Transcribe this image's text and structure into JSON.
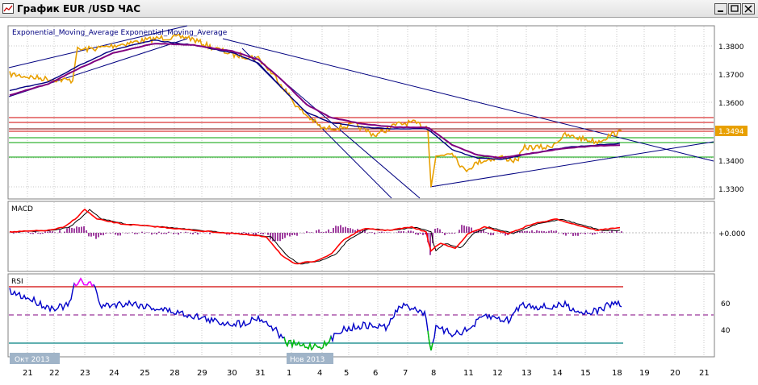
{
  "window": {
    "title": "График EUR /USD  ЧАС",
    "buttons": [
      "minimize",
      "maximize",
      "close"
    ]
  },
  "indicators_label": "Exponential_Moving_Average Exponential_Moving_Average",
  "price_axis": [
    "1.3800",
    "1.3700",
    "1.3600",
    "1.3400",
    "1.3300"
  ],
  "current_price": "1.3494",
  "macd_label": "MACD",
  "macd_axis": [
    "+0.000"
  ],
  "rsi_label": "RSI",
  "rsi_axis": [
    "60",
    "40"
  ],
  "month_labels": [
    "Окт 2013",
    "Нов 2013"
  ],
  "date_labels": [
    "21",
    "22",
    "23",
    "24",
    "25",
    "28",
    "29",
    "30",
    "31",
    "1",
    "4",
    "5",
    "6",
    "7",
    "8",
    "11",
    "12",
    "13",
    "14",
    "15",
    "18",
    "19",
    "20",
    "21"
  ],
  "colors": {
    "price": "#e8a000",
    "ema_fast": "#000080",
    "ema_slow": "#800080",
    "macd_line": "#ff0000",
    "signal": "#000000",
    "histogram": "#800080",
    "rsi": "#0000c8",
    "rsi_over": "#ff00ff",
    "rsi_under": "#00c800",
    "hline_red": "#d00000",
    "hline_green": "#00a000"
  }
}
